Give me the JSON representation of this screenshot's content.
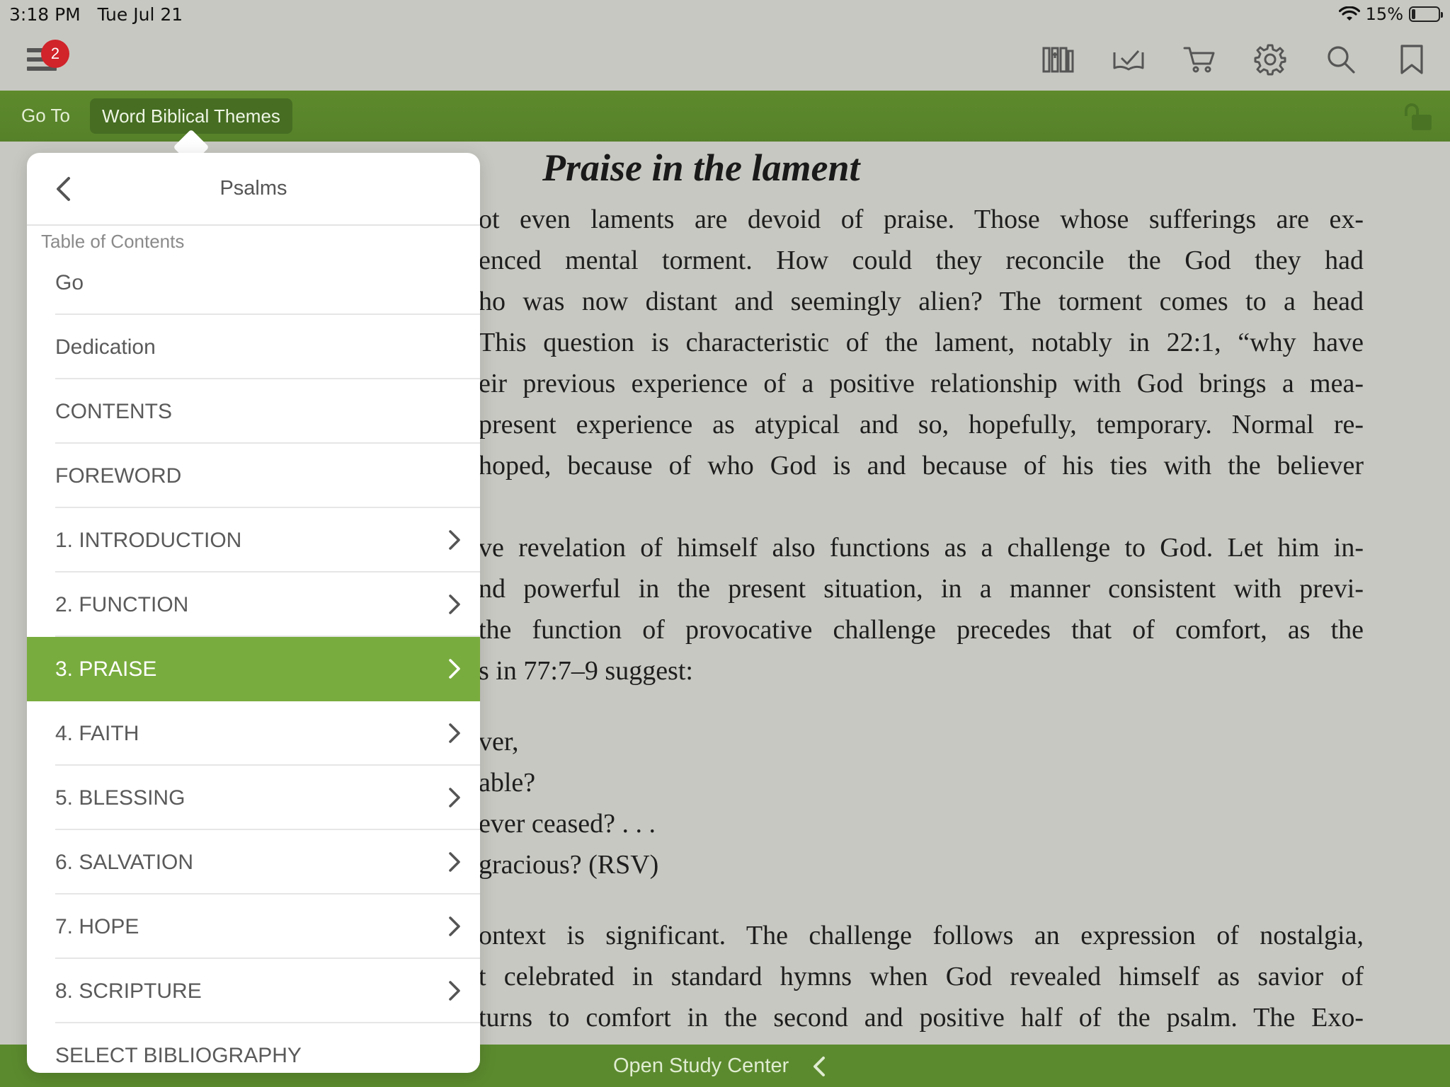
{
  "status_bar": {
    "time": "3:18 PM",
    "date": "Tue Jul 21",
    "battery": "15%",
    "battery_level": 0.15
  },
  "toolbar": {
    "menu_badge": "2",
    "icons": [
      "library-icon",
      "reading-plan-icon",
      "cart-icon",
      "settings-icon",
      "search-icon",
      "bookmark-icon"
    ]
  },
  "nav": {
    "goto_label": "Go To",
    "breadcrumb": "Word Biblical Themes"
  },
  "document": {
    "title": "Praise in the lament",
    "lines": [
      "ot even laments are devoid of praise. Those whose sufferings are ex-",
      "enced mental torment. How could they reconcile the God they had",
      "ho was now distant and seemingly alien? The torment comes to a head",
      "This question is characteristic of the lament, notably in 22:1, “why have",
      "eir previous experience of a positive relationship with God brings a mea-",
      "present experience as atypical and so, hopefully, temporary. Normal re-",
      "hoped, because of who God is and because of his ties with the believer",
      "ve revelation of himself also functions as a challenge to God. Let him in-",
      "nd powerful in the present situation, in a manner consistent with previ-",
      " the function of provocative challenge precedes that of comfort, as the",
      "s in 77:7–9 suggest:",
      "ver,",
      "able?",
      " ever ceased? . . .",
      "gracious? (RSV)",
      "ontext is significant. The challenge follows an expression of nostalgia,",
      "t celebrated in standard hymns when God revealed himself as savior of",
      " turns to comfort in the second and positive half of the psalm. The Exo-"
    ]
  },
  "popover": {
    "title": "Psalms",
    "section_label": "Table of Contents",
    "items": [
      {
        "label": "Go",
        "has_children": false,
        "selected": false
      },
      {
        "label": "Dedication",
        "has_children": false,
        "selected": false
      },
      {
        "label": "CONTENTS",
        "has_children": false,
        "selected": false
      },
      {
        "label": "FOREWORD",
        "has_children": false,
        "selected": false
      },
      {
        "label": "1. INTRODUCTION",
        "has_children": true,
        "selected": false
      },
      {
        "label": "2. FUNCTION",
        "has_children": true,
        "selected": false
      },
      {
        "label": "3. PRAISE",
        "has_children": true,
        "selected": true
      },
      {
        "label": "4. FAITH",
        "has_children": true,
        "selected": false
      },
      {
        "label": "5. BLESSING",
        "has_children": true,
        "selected": false
      },
      {
        "label": "6. SALVATION",
        "has_children": true,
        "selected": false
      },
      {
        "label": "7. HOPE",
        "has_children": true,
        "selected": false
      },
      {
        "label": "8. SCRIPTURE",
        "has_children": true,
        "selected": false
      },
      {
        "label": "SELECT BIBLIOGRAPHY",
        "has_children": false,
        "selected": false
      }
    ]
  },
  "bottom_bar": {
    "study_label": "Open Study Center"
  },
  "colors": {
    "accent_green": "#79ac3e",
    "nav_green": "#5e8a2c",
    "badge_red": "#d0232a"
  }
}
